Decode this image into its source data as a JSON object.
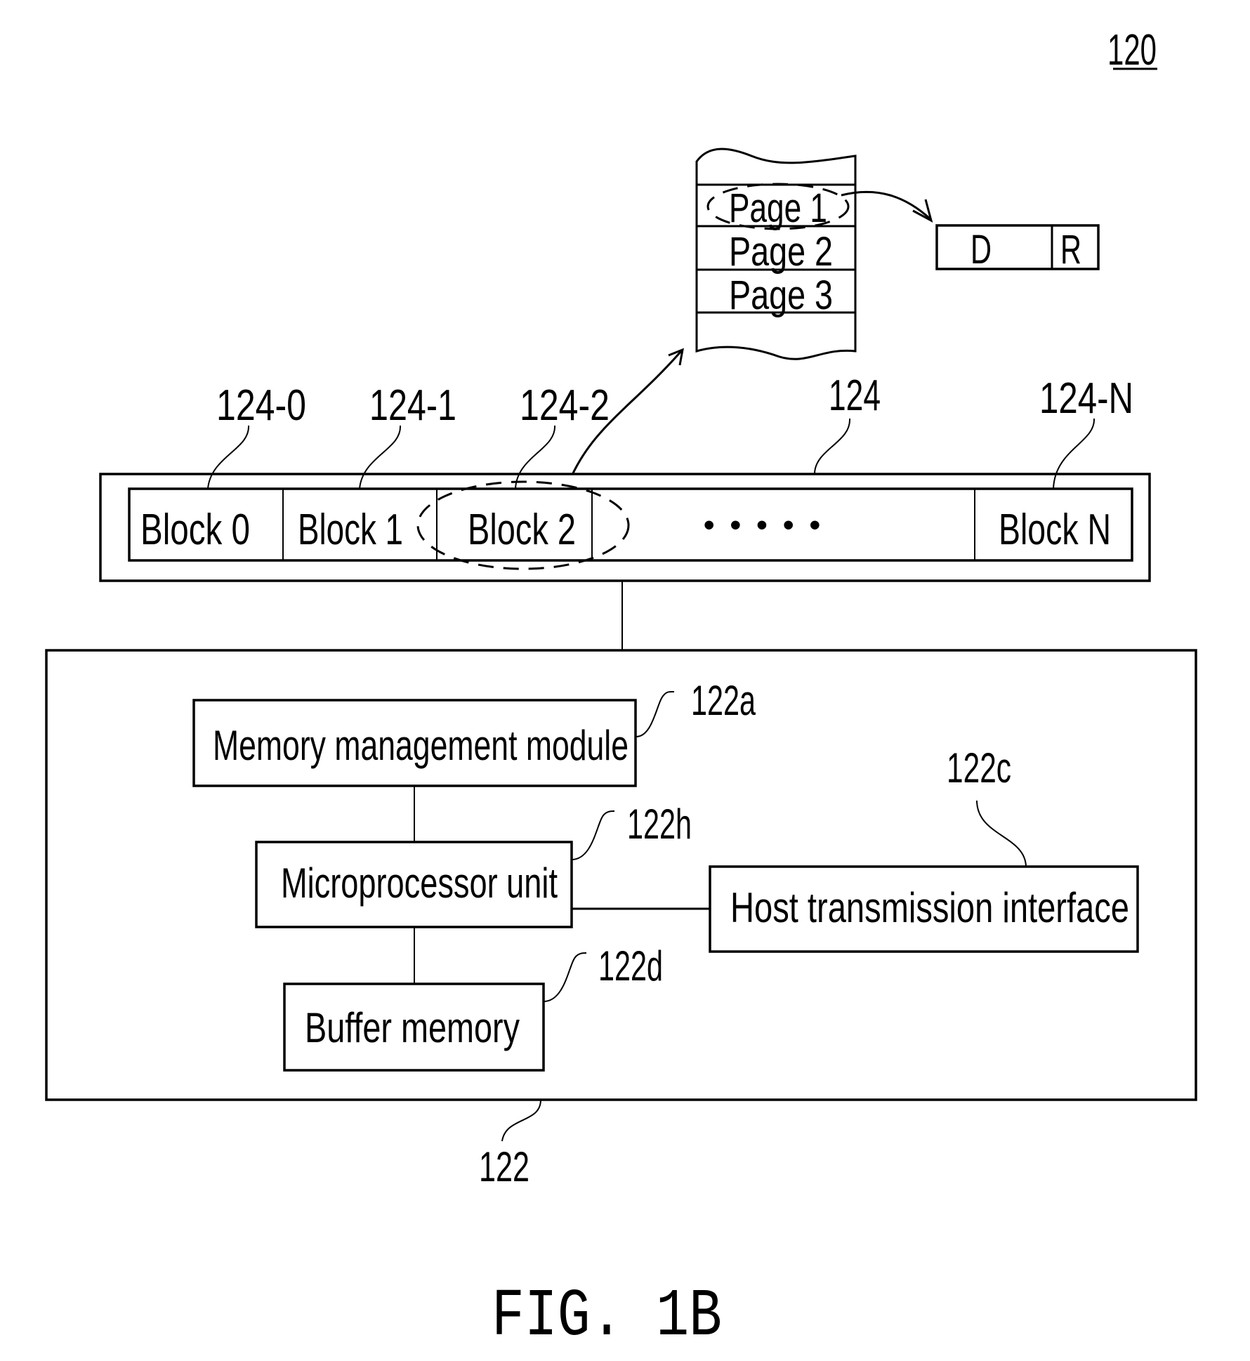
{
  "figure": {
    "reference": "120",
    "caption": "FIG. 1B"
  },
  "memory": {
    "reference": "124",
    "blocks": [
      {
        "label": "Block 0",
        "ref": "124-0"
      },
      {
        "label": "Block 1",
        "ref": "124-1"
      },
      {
        "label": "Block 2",
        "ref": "124-2"
      },
      {
        "label": "• • • • •",
        "ref": ""
      },
      {
        "label": "Block N",
        "ref": "124-N"
      }
    ],
    "pages": [
      "Page 1",
      "Page 2",
      "Page 3"
    ],
    "page_fields": [
      "D",
      "R"
    ]
  },
  "controller": {
    "reference": "122",
    "modules": [
      {
        "label": "Memory management module",
        "ref": "122a"
      },
      {
        "label": "Microprocessor unit",
        "ref": "122h"
      },
      {
        "label": "Host transmission interface",
        "ref": "122c"
      },
      {
        "label": "Buffer memory",
        "ref": "122d"
      }
    ]
  }
}
